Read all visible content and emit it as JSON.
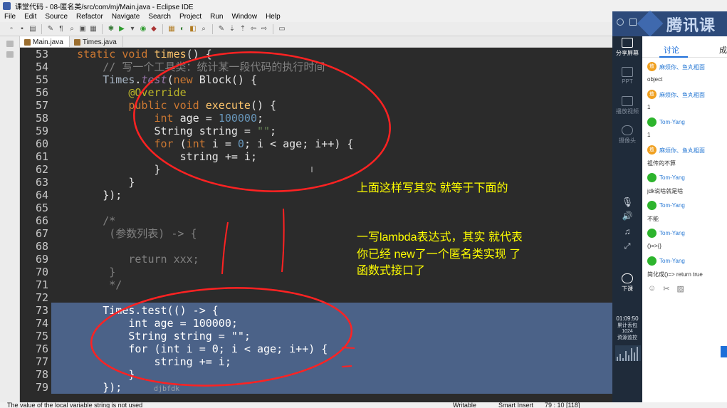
{
  "window": {
    "title": "课堂代码 - 08-匿名类/src/com/mj/Main.java - Eclipse IDE"
  },
  "menu": [
    "File",
    "Edit",
    "Source",
    "Refactor",
    "Navigate",
    "Search",
    "Project",
    "Run",
    "Window",
    "Help"
  ],
  "tabs": [
    {
      "label": "Main.java",
      "active": true
    },
    {
      "label": "Times.java",
      "active": false
    }
  ],
  "code": [
    {
      "n": "53",
      "text": "    static void times() {"
    },
    {
      "n": "54",
      "text": "        // 写一个工具类：统计某一段代码的执行时间"
    },
    {
      "n": "55",
      "text": "        Times.test(new Block() {"
    },
    {
      "n": "56",
      "text": "            @Override"
    },
    {
      "n": "57",
      "text": "            public void execute() {"
    },
    {
      "n": "58",
      "text": "                int age = 100000;"
    },
    {
      "n": "59",
      "text": "                String string = \"\";"
    },
    {
      "n": "60",
      "text": "                for (int i = 0; i < age; i++) {"
    },
    {
      "n": "61",
      "text": "                    string += i;"
    },
    {
      "n": "62",
      "text": "                }"
    },
    {
      "n": "63",
      "text": "            }"
    },
    {
      "n": "64",
      "text": "        });"
    },
    {
      "n": "65",
      "text": ""
    },
    {
      "n": "66",
      "text": "        /*"
    },
    {
      "n": "67",
      "text": "         (参数列表) -> {"
    },
    {
      "n": "68",
      "text": ""
    },
    {
      "n": "69",
      "text": "            return xxx;"
    },
    {
      "n": "70",
      "text": "         }"
    },
    {
      "n": "71",
      "text": "         */"
    },
    {
      "n": "72",
      "text": ""
    },
    {
      "n": "73",
      "text": "        Times.test(() -> {"
    },
    {
      "n": "74",
      "text": "            int age = 100000;"
    },
    {
      "n": "75",
      "text": "            String string = \"\";"
    },
    {
      "n": "76",
      "text": "            for (int i = 0; i < age; i++) {"
    },
    {
      "n": "77",
      "text": "                string += i;"
    },
    {
      "n": "78",
      "text": "            }"
    },
    {
      "n": "79",
      "text": "        });"
    }
  ],
  "notes": {
    "n1": "上面这样写其实 就等于下面的",
    "n2a": "一写lambda表达式，其实 就代表",
    "n2b": "你已经 new了一个匿名类实现 了",
    "n2c": "函数式接口了",
    "scribble": "djbfdk"
  },
  "status": {
    "message": "The value of the local variable string is not used",
    "writable": "Writable",
    "insert": "Smart Insert",
    "position": "79 : 10 [118]"
  },
  "side_panel": {
    "logo": "腾讯课",
    "buttons": [
      {
        "label": "分享屏幕",
        "active": true
      },
      {
        "label": "PPT",
        "active": false
      },
      {
        "label": "播放视频",
        "active": false
      },
      {
        "label": "摄像头",
        "active": false
      },
      {
        "label": "下课",
        "active": true
      }
    ],
    "time": "01:09:50",
    "stats_a": "累计丢包",
    "stats_b": "1024",
    "stats_c": "资源监控"
  },
  "chat": {
    "tab_discuss": "讨论",
    "tab_other": "成",
    "messages": [
      {
        "name": "麻烦你、鱼丸粗面",
        "badge": "敖",
        "type": "o",
        "text": "object"
      },
      {
        "name": "麻烦你、鱼丸粗面",
        "badge": "敖",
        "type": "o",
        "text": "1"
      },
      {
        "name": "Tom-Yang",
        "badge": "",
        "type": "g",
        "text": "1"
      },
      {
        "name": "麻烦你、鱼丸粗面",
        "badge": "敖",
        "type": "o",
        "text": "祖传的不算"
      },
      {
        "name": "Tom-Yang",
        "badge": "",
        "type": "g",
        "text": "jdk说啥就是啥"
      },
      {
        "name": "Tom-Yang",
        "badge": "",
        "type": "g",
        "text": "不能"
      },
      {
        "name": "Tom-Yang",
        "badge": "",
        "type": "g",
        "text": "()=>{}"
      },
      {
        "name": "Tom-Yang",
        "badge": "",
        "type": "g",
        "text": "简化成()=> return true"
      }
    ]
  }
}
